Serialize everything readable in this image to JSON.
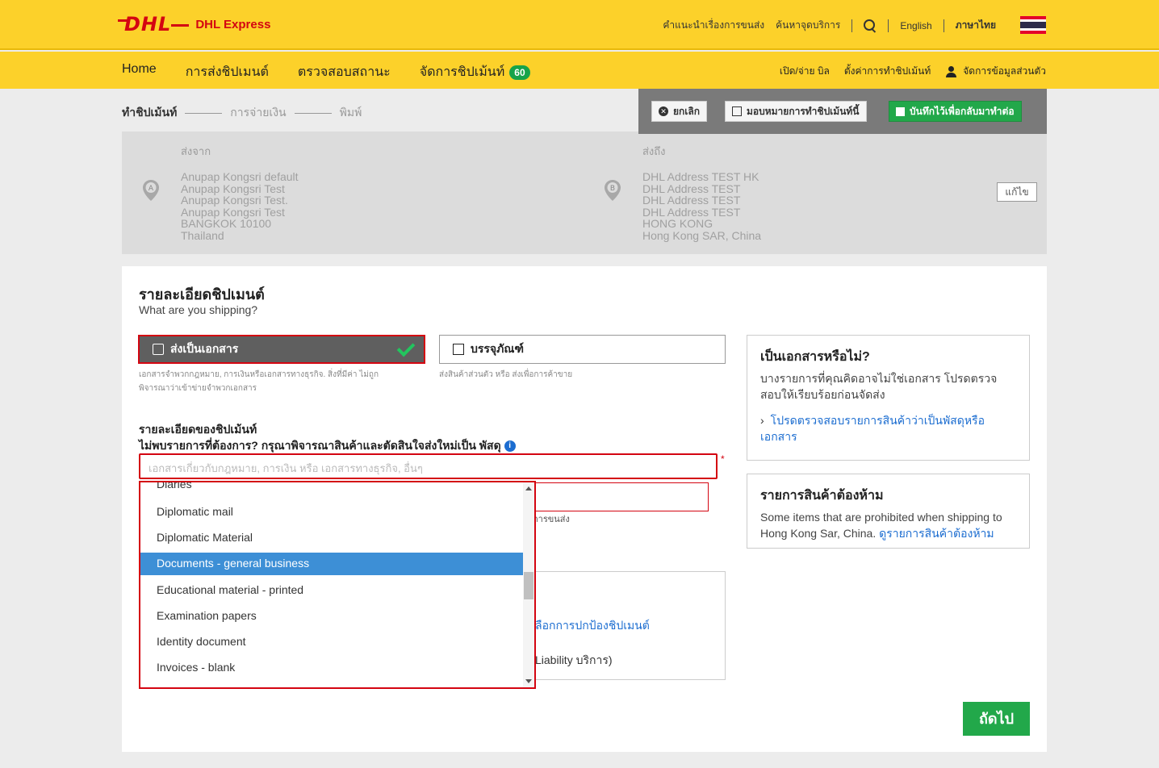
{
  "brand": {
    "logo": "DHL",
    "name": "DHL Express",
    "red": "#d40511",
    "yellow": "#fcd12a",
    "green": "#22a84a"
  },
  "topbar": {
    "links": [
      "คำแนะนำเรื่องการขนส่ง",
      "ค้นหาจุดบริการ"
    ],
    "lang_en": "English",
    "lang_th": "ภาษาไทย"
  },
  "nav": {
    "items": [
      {
        "label": "Home"
      },
      {
        "label": "การส่งชิปเมนต์"
      },
      {
        "label": "ตรวจสอบสถานะ"
      },
      {
        "label": "จัดการชิปเม้นท์",
        "badge": "60"
      }
    ],
    "right": [
      "เปิด/จ่าย บิล",
      "ตั้งค่าการทำชิปเม้นท์",
      "จัดการข้อมูลส่วนตัว"
    ]
  },
  "steps": [
    "ทำชิปเม้นท์",
    "การจ่ายเงิน",
    "พิมพ์"
  ],
  "actions": {
    "cancel": "ยกเลิก",
    "assign": "มอบหมายการทำชิปเม้นท์นี้",
    "save": "บันทึกไว้เพื่อกลับมาทำต่อ"
  },
  "from": {
    "title": "ส่งจาก",
    "pin": "A",
    "lines": [
      "Anupap Kongsri default",
      "Anupap Kongsri Test",
      "Anupap Kongsri Test.",
      "Anupap Kongsri Test",
      "BANGKOK 10100",
      "Thailand"
    ]
  },
  "to": {
    "title": "ส่งถึง",
    "pin": "B",
    "lines": [
      "DHL Address TEST HK",
      "DHL Address TEST",
      "DHL Address TEST",
      "DHL Address TEST",
      "HONG KONG",
      "Hong Kong SAR, China"
    ]
  },
  "edit_label": "แก้ไข",
  "shipment": {
    "title": "รายละเอียดชิปเมนต์",
    "subtitle": "What are you shipping?",
    "doc_label": "ส่งเป็นเอกสาร",
    "doc_hint_1": "เอกสารจำพวกกฎหมาย, การเงินหรือเอกสารทางธุรกิจ. สิ่งที่มีค่า ไม่ถูก",
    "doc_hint_2": "พิจารณาว่าเข้าข่ายจำพวกเอกสาร",
    "pkg_label": "บรรจุภัณฑ์",
    "pkg_hint": "ส่งสินค้าส่วนตัว หรือ ส่งเพื่อการค้าขาย",
    "details_title": "รายละเอียดของชิปเม้นท์",
    "details_sub": "ไม่พบรายการที่ต้องการ? กรุณาพิจารณาสินค้าและตัดสินใจส่งใหม่เป็น พัสดุ",
    "search_placeholder": "เอกสารเกี่ยวกับกฎหมาย, การเงิน หรือ เอกสารทางธุรกิจ, อื่นๆ",
    "required_mark": "*",
    "field2_hint": "การขนส่ง",
    "protect_link": "ลือกการปกป้องชิปเมนต์",
    "liability": "Liability บริการ)"
  },
  "dropdown": {
    "items": [
      "Diaries",
      "Diplomatic mail",
      "Diplomatic Material",
      "Documents - general business",
      "Educational material - printed",
      "Examination papers",
      "Identity document",
      "Invoices - blank"
    ],
    "selected": "Documents - general business"
  },
  "info_doc": {
    "title": "เป็นเอกสารหรือไม่?",
    "text": "บางรายการที่คุณคิดอาจไม่ใช่เอกสาร โปรดตรวจสอบให้เรียบร้อยก่อนจัดส่ง",
    "link": "โปรดตรวจสอบรายการสินค้าว่าเป็นพัสดุหรือเอกสาร"
  },
  "info_prohibited": {
    "title": "รายการสินค้าต้องห้าม",
    "text": "Some items that are prohibited when shipping to Hong Kong Sar, China.",
    "link": "ดูรายการสินค้าต้องห้าม"
  },
  "next_label": "ถัดไป"
}
